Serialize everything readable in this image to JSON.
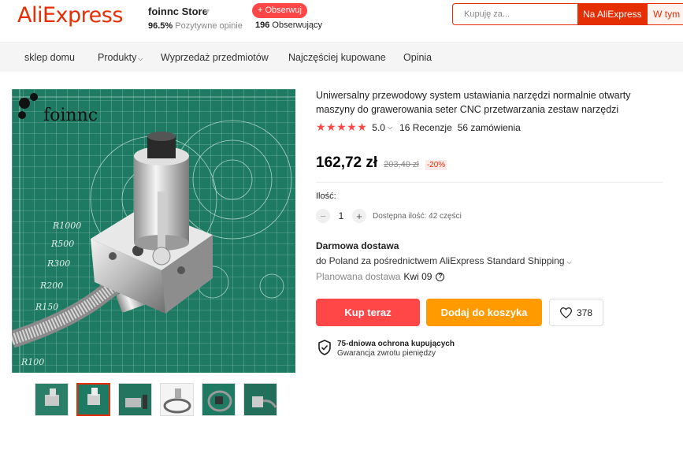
{
  "header": {
    "logo": "AliExpress",
    "store_name": "foinnc Store",
    "positive_pct": "96.5%",
    "positive_label": "Pozytywne opinie",
    "follow_label": "+ Obserwuj",
    "followers_count": "196",
    "followers_label": "Obserwujący",
    "search_placeholder": "Kupuję za...",
    "search_aliexpress": "Na AliExpress",
    "search_store": "W tym"
  },
  "nav": {
    "items": [
      "sklep domu",
      "Produkty",
      "Wyprzedaż przedmiotów",
      "Najczęściej kupowane",
      "Opinia"
    ]
  },
  "gallery": {
    "watermark": "foinnc",
    "thumbnail_count": 6,
    "active_thumbnail": 2
  },
  "product": {
    "title": "Uniwersalny przewodowy system ustawiania narzędzi normalnie otwarty maszyny do grawerowania seter CNC przetwarzania zestaw narzędzi",
    "rating": "5.0",
    "reviews": "16 Recenzje",
    "orders": "56 zamówienia",
    "price": "162,72 zł",
    "old_price": "203,40 zł",
    "discount": "-20%",
    "qty_label": "Ilość:",
    "qty_value": "1",
    "qty_available": "Dostępna ilość: 42 części",
    "shipping_title": "Darmowa dostawa",
    "shipping_desc": "do Poland za pośrednictwem AliExpress Standard Shipping",
    "delivery_label": "Planowana dostawa",
    "delivery_date": "Kwi 09",
    "buy_now": "Kup teraz",
    "add_to_cart": "Dodaj do koszyka",
    "wishlist_count": "378",
    "protection_title": "75-dniowa ochrona kupujących",
    "protection_sub": "Gwarancja zwrotu pieniędzy"
  },
  "colors": {
    "brand_red": "#e62e04",
    "buy_red": "#ff4747",
    "cart_orange": "#ff9a00",
    "mat_green": "#1f7a63"
  }
}
